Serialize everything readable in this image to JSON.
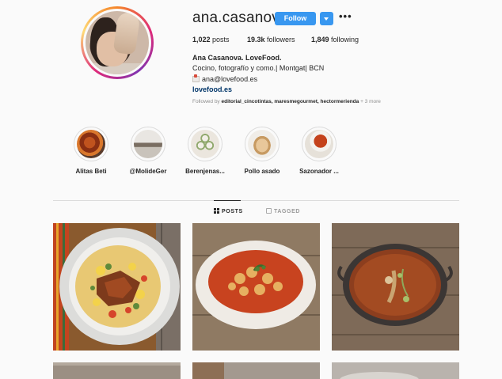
{
  "profile": {
    "username": "ana.casanova",
    "follow_label": "Follow",
    "more_label": "•••",
    "stats": {
      "posts_count": "1,022",
      "posts_label": "posts",
      "followers_count": "19.3k",
      "followers_label": "followers",
      "following_count": "1,849",
      "following_label": "following"
    },
    "bio": {
      "name": "Ana Casanova. LoveFood.",
      "description": "Cocino, fotografío y como.| Montgat| BCN",
      "email": "ana@lovefood.es",
      "website": "lovefood.es"
    },
    "followed_by": {
      "prefix": "Followed by",
      "names": "editorial_cincotintas, maresmegourmet, hectormerienda",
      "more": "+ 3 more"
    }
  },
  "highlights": [
    {
      "label": "Alitas Beti",
      "icon": "chicken-wings"
    },
    {
      "label": "@MolideGer",
      "icon": "kitchen-person"
    },
    {
      "label": "Berenjenas...",
      "icon": "eggplant-plate"
    },
    {
      "label": "Pollo asado",
      "icon": "roast-chicken"
    },
    {
      "label": "Sazonador ...",
      "icon": "spice-bowl"
    }
  ],
  "tabs": {
    "posts": "POSTS",
    "tagged": "TAGGED"
  },
  "colors": {
    "follow_blue": "#3897f0",
    "link_blue": "#003569",
    "text": "#262626",
    "muted": "#8e8e8e"
  },
  "posts": [
    {
      "icon": "rice-with-chicken-plate"
    },
    {
      "icon": "chickpea-stew-bowl"
    },
    {
      "icon": "paella-pan"
    },
    {
      "icon": "post-image"
    },
    {
      "icon": "post-image"
    },
    {
      "icon": "post-image"
    }
  ]
}
